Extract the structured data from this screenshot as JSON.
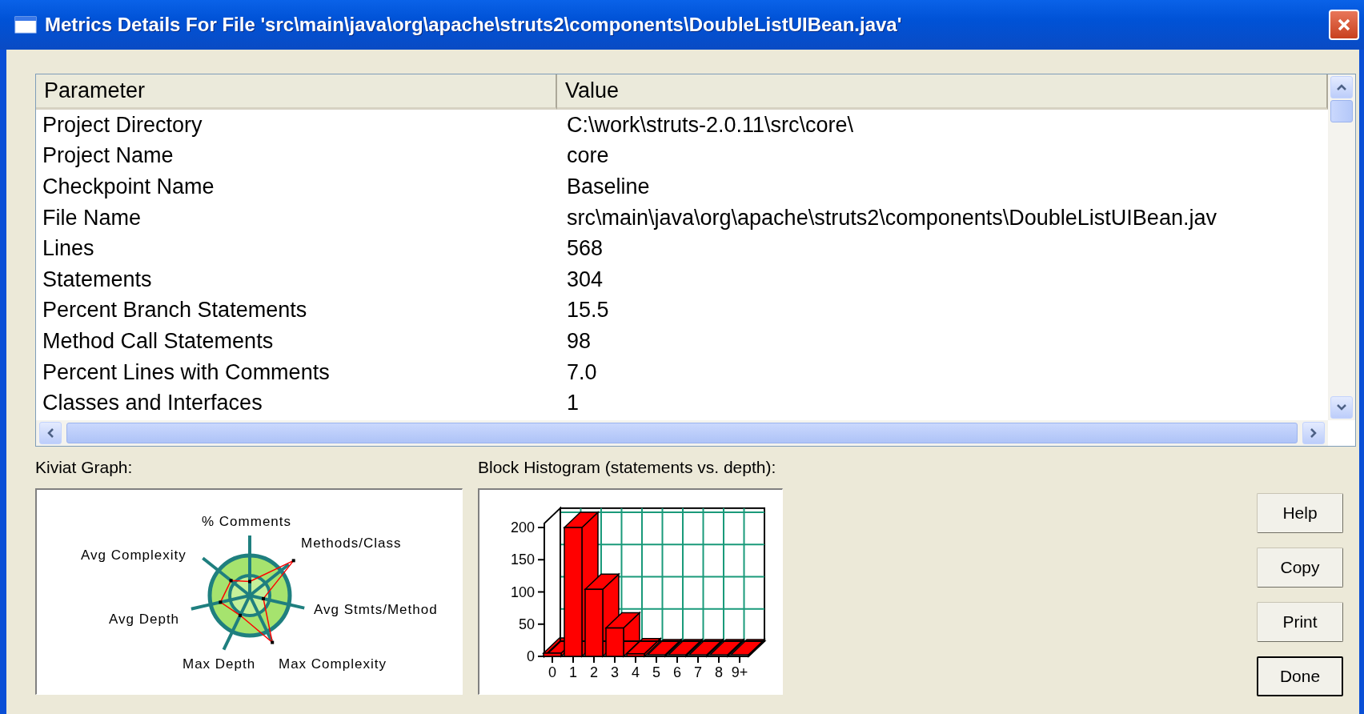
{
  "window": {
    "title": "Metrics Details For File 'src\\main\\java\\org\\apache\\struts2\\components\\DoubleListUIBean.java'"
  },
  "table": {
    "columns": [
      "Parameter",
      "Value"
    ],
    "rows": [
      {
        "parameter": "Project Directory",
        "value": "C:\\work\\struts-2.0.11\\src\\core\\"
      },
      {
        "parameter": "Project Name",
        "value": "core"
      },
      {
        "parameter": "Checkpoint Name",
        "value": "Baseline"
      },
      {
        "parameter": "File Name",
        "value": "src\\main\\java\\org\\apache\\struts2\\components\\DoubleListUIBean.jav"
      },
      {
        "parameter": "Lines",
        "value": "568"
      },
      {
        "parameter": "Statements",
        "value": "304"
      },
      {
        "parameter": "Percent Branch Statements",
        "value": "15.5"
      },
      {
        "parameter": "Method Call Statements",
        "value": "98"
      },
      {
        "parameter": "Percent Lines with Comments",
        "value": "7.0"
      },
      {
        "parameter": "Classes and Interfaces",
        "value": "1"
      }
    ]
  },
  "kiviat": {
    "label": "Kiviat Graph:",
    "axes": [
      "% Comments",
      "Methods/Class",
      "Avg Complexity",
      "Avg Stmts/Method",
      "Avg Depth",
      "Max Depth",
      "Max Complexity"
    ]
  },
  "histogram": {
    "label": "Block Histogram (statements vs. depth):",
    "chart_data": {
      "type": "bar",
      "categories": [
        "0",
        "1",
        "2",
        "3",
        "4",
        "5",
        "6",
        "7",
        "8",
        "9+"
      ],
      "series": [
        {
          "color": "#ff0000",
          "values": [
            5,
            200,
            104,
            44,
            4,
            0,
            0,
            0,
            0,
            0
          ]
        }
      ],
      "ylim": [
        0,
        230
      ],
      "yticks": [
        0,
        50,
        100,
        150,
        200
      ]
    }
  },
  "buttons": [
    {
      "label": "Help",
      "default": false
    },
    {
      "label": "Copy",
      "default": false
    },
    {
      "label": "Print",
      "default": false
    },
    {
      "label": "Done",
      "default": true
    }
  ]
}
